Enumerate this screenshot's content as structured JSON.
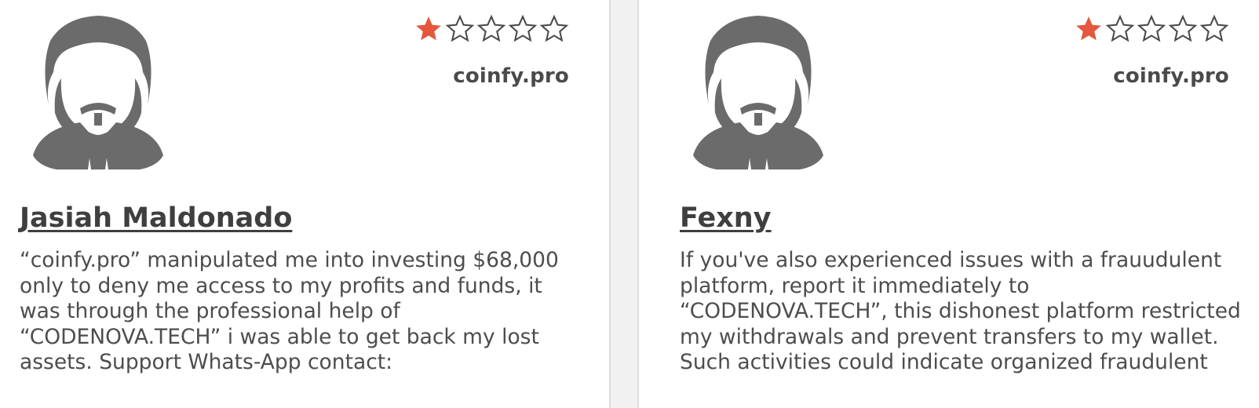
{
  "colors": {
    "star_filled": "#e4573d",
    "star_outline": "#4a4a4a",
    "avatar": "#6b6b6b"
  },
  "reviews": [
    {
      "site": "coinfy.pro",
      "rating": 1,
      "max_rating": 5,
      "name": "Jasiah Maldonado",
      "avatar_icon": "user-avatar-icon",
      "lines": [
        "“coinfy.pro” manipulated me into investing $68,000",
        "only to deny me access to my profits and funds, it",
        "was through the professional help of",
        "“CODENOVA.TECH” i was able to get back my lost",
        "assets. Support Whats-App contact:"
      ]
    },
    {
      "site": "coinfy.pro",
      "rating": 1,
      "max_rating": 5,
      "name": "Fexny",
      "avatar_icon": "user-avatar-icon",
      "lines": [
        "If you've also experienced issues with a frauudulent",
        "platform, report it immediately to",
        "“CODENOVA.TECH”, this dishonest platform restricted",
        "my withdrawals and prevent transfers to my wallet.",
        "Such activities could indicate organized fraudulent"
      ]
    }
  ]
}
